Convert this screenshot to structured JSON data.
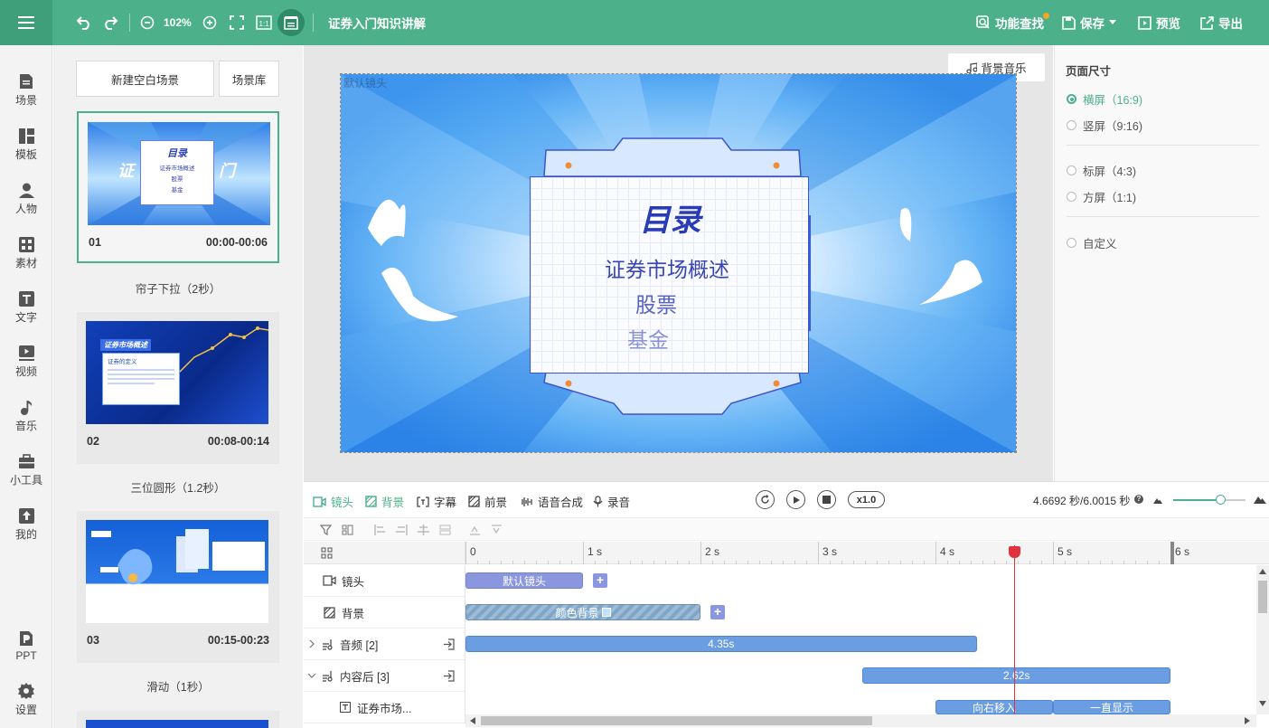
{
  "toolbar": {
    "zoom": "102%",
    "title": "证券入门知识讲解",
    "find_label": "功能查找",
    "save_label": "保存",
    "preview_label": "预览",
    "export_label": "导出"
  },
  "left_nav": [
    {
      "label": "场景",
      "icon": "scene-icon"
    },
    {
      "label": "模板",
      "icon": "template-icon"
    },
    {
      "label": "人物",
      "icon": "person-icon"
    },
    {
      "label": "素材",
      "icon": "material-icon"
    },
    {
      "label": "文字",
      "icon": "text-icon"
    },
    {
      "label": "视频",
      "icon": "video-icon"
    },
    {
      "label": "音乐",
      "icon": "music-icon"
    },
    {
      "label": "小工具",
      "icon": "toolbox-icon"
    },
    {
      "label": "我的",
      "icon": "upload-icon"
    },
    {
      "label": "PPT",
      "icon": "ppt-icon"
    },
    {
      "label": "设置",
      "icon": "gear-icon"
    }
  ],
  "scenes_panel": {
    "new_blank": "新建空白场景",
    "library": "场景库",
    "scenes": [
      {
        "num": "01",
        "time": "00:00-00:06",
        "transition": "帘子下拉（2秒）",
        "thumb_title": "目录",
        "thumb_lines": [
          "证券市场概述",
          "股票",
          "基金"
        ],
        "thumb_bg_text": "证",
        "thumb_bg_text2": "门"
      },
      {
        "num": "02",
        "time": "00:08-00:14",
        "transition": "三位圆形（1.2秒）",
        "thumb_title": "证券市场概述",
        "thumb_sub": "证券的定义"
      },
      {
        "num": "03",
        "time": "00:15-00:23",
        "transition": "滑动（1秒）"
      }
    ]
  },
  "stage": {
    "corner_label": "默认镜头",
    "bg_music_label": "背景音乐",
    "content_title": "目录",
    "items": [
      "证券市场概述",
      "股票",
      "基金"
    ]
  },
  "page_size": {
    "title": "页面尺寸",
    "options": [
      {
        "label": "横屏（16:9)",
        "selected": true
      },
      {
        "label": "竖屏（9:16)",
        "selected": false
      },
      {
        "label": "标屏（4:3)",
        "selected": false
      },
      {
        "label": "方屏（1:1)",
        "selected": false
      },
      {
        "label": "自定义",
        "selected": false
      }
    ]
  },
  "timeline": {
    "tabs": [
      {
        "label": "镜头",
        "icon": "camera-icon",
        "active": true
      },
      {
        "label": "背景",
        "icon": "background-icon",
        "active": true
      },
      {
        "label": "字幕",
        "icon": "subtitle-icon",
        "active": false
      },
      {
        "label": "前景",
        "icon": "foreground-icon",
        "active": false
      },
      {
        "label": "语音合成",
        "icon": "voice-icon",
        "active": false
      },
      {
        "label": "录音",
        "icon": "mic-icon",
        "active": false
      }
    ],
    "speed": "x1.0",
    "time_readout": "4.6692 秒/6.0015 秒",
    "ruler": [
      {
        "label": "0",
        "t": 0
      },
      {
        "label": "1 s",
        "t": 1
      },
      {
        "label": "2 s",
        "t": 2
      },
      {
        "label": "3 s",
        "t": 3
      },
      {
        "label": "4 s",
        "t": 4
      },
      {
        "label": "5 s",
        "t": 5
      },
      {
        "label": "6 s",
        "t": 6
      }
    ],
    "playhead_seconds": 4.6692,
    "tracks": [
      {
        "label": "镜头"
      },
      {
        "label": "背景"
      },
      {
        "label": "音频 [2]"
      },
      {
        "label": "内容后 [3]"
      },
      {
        "label": "证券市场..."
      }
    ],
    "clips": [
      {
        "track": 0,
        "start": 0,
        "end": 1.0,
        "label": "默认镜头",
        "kind": "camera"
      },
      {
        "track": 1,
        "start": 0,
        "end": 2.0,
        "label": "颜色背景",
        "kind": "background"
      },
      {
        "track": 2,
        "start": 0,
        "end": 4.35,
        "label": "4.35s",
        "kind": "audio"
      },
      {
        "track": 3,
        "start": 3.38,
        "end": 6.0,
        "label": "2.62s",
        "kind": "audio"
      },
      {
        "track": 4,
        "start": 4.0,
        "end": 5.0,
        "label": "向右移入",
        "kind": "anim"
      },
      {
        "track": 4,
        "start": 5.0,
        "end": 6.0,
        "label": "一直显示",
        "kind": "anim"
      }
    ]
  },
  "colors": {
    "brand": "#4cb08a",
    "clip_blue": "#6a9de2",
    "clip_camera": "#8a96de",
    "playhead": "#e0323c"
  }
}
